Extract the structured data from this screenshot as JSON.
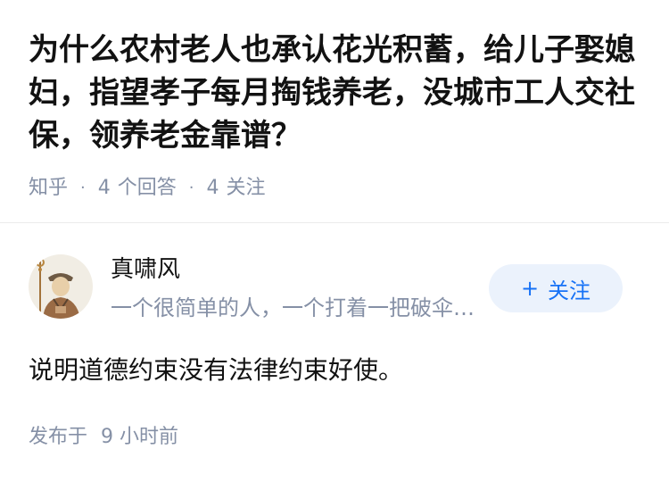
{
  "question": {
    "title": "为什么农村老人也承认花光积蓄，给儿子娶媳妇，指望孝子每月掏钱养老，没城市工人交社保，领养老金靠谱？",
    "source": "知乎",
    "answers_count": "4",
    "answers_label": "个回答",
    "followers_count": "4",
    "followers_label": "关注"
  },
  "answer": {
    "author_name": "真啸风",
    "author_bio": "一个很简单的人，一个打着一把破伞的人",
    "follow_button": {
      "icon": "plus-icon",
      "label": "关注"
    },
    "content": "说明道德约束没有法律约束好使。",
    "published_prefix": "发布于",
    "published_time": "9 小时前"
  },
  "colors": {
    "title": "#121212",
    "meta": "#8590a6",
    "follow_bg": "#ebf2fc",
    "follow_text": "#1772f6"
  }
}
